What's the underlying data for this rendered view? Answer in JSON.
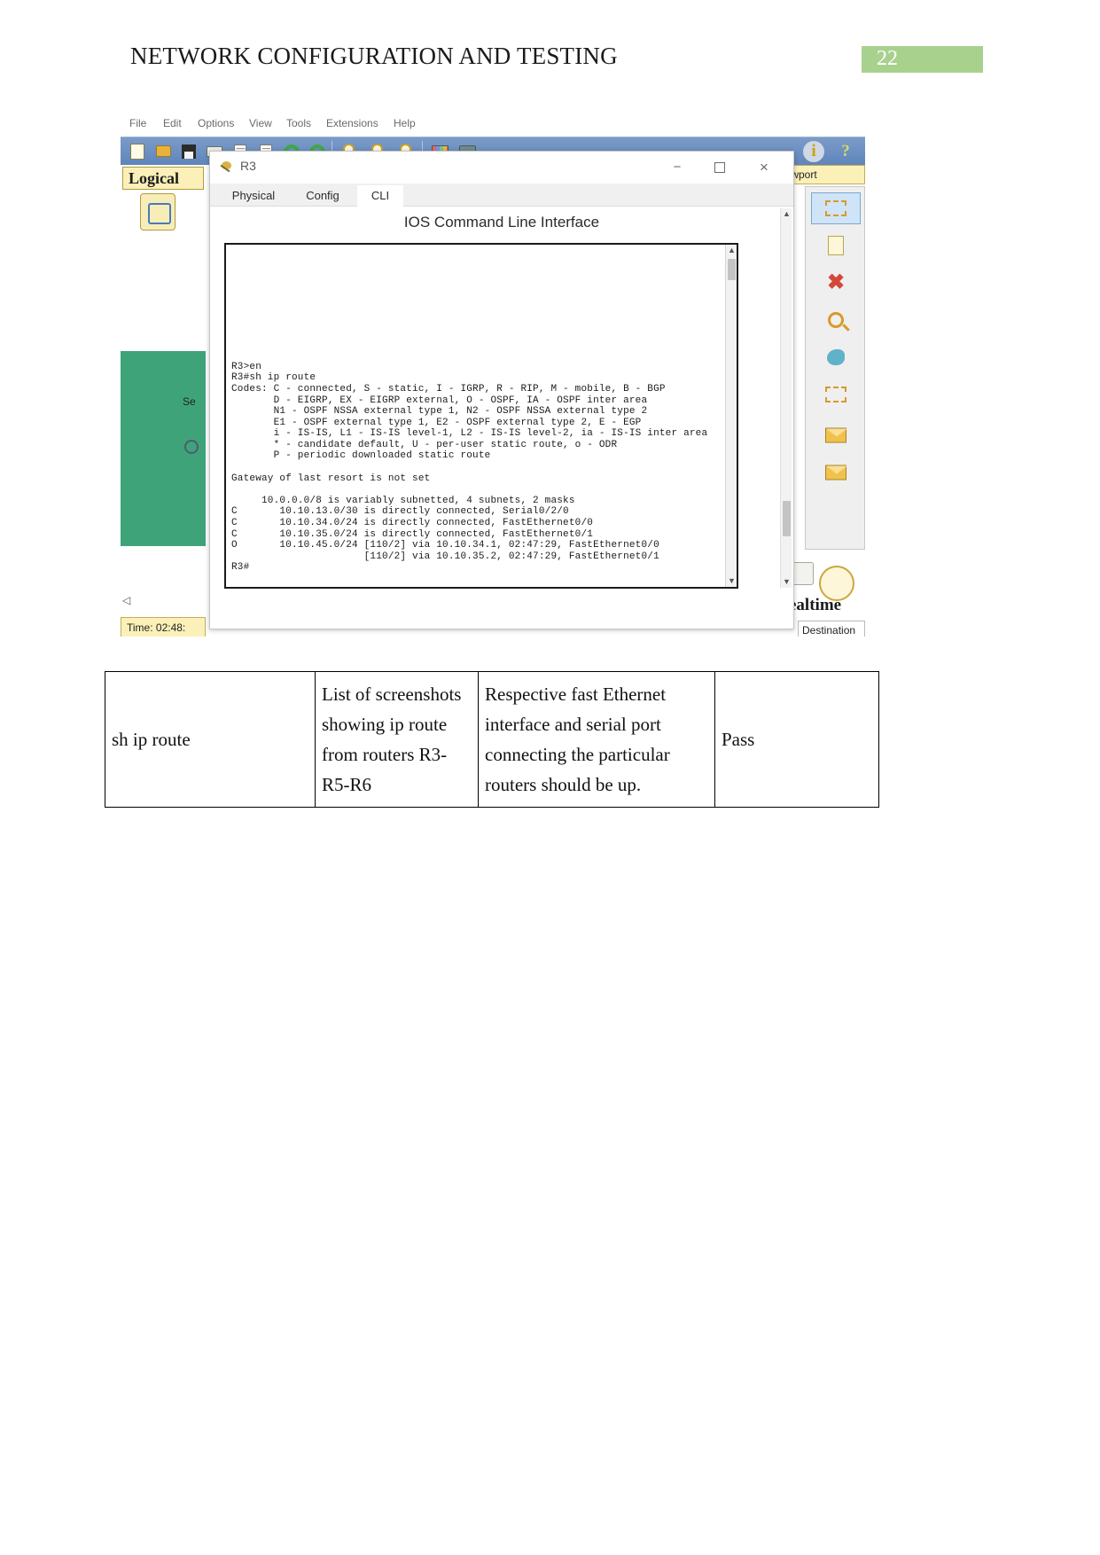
{
  "document": {
    "title": "NETWORK CONFIGURATION AND TESTING",
    "page_number": "22"
  },
  "packet_tracer": {
    "menu": [
      "File",
      "Edit",
      "Options",
      "View",
      "Tools",
      "Extensions",
      "Help"
    ],
    "toolbar_icons": [
      "new-file-icon",
      "open-folder-icon",
      "save-icon",
      "print-icon",
      "copy-icon",
      "paste-icon",
      "undo-icon",
      "redo-icon",
      "zoom-in-icon",
      "zoom-fit-icon",
      "zoom-out-icon",
      "palette-icon",
      "custom-device-icon"
    ],
    "info_icon": "i",
    "help_icon": "?",
    "logical_tab": "Logical",
    "viewport_tab": "iewport",
    "time_label": "Time: 02:48:",
    "realtime_label": "ealtime",
    "destination_label": "Destination",
    "scenario_label": "Se"
  },
  "r3_dialog": {
    "title": "R3",
    "window_buttons": {
      "minimize": "−",
      "maximize": "",
      "close": "×"
    },
    "tabs": [
      {
        "label": "Physical",
        "active": false
      },
      {
        "label": "Config",
        "active": false
      },
      {
        "label": "CLI",
        "active": true
      }
    ],
    "heading": "IOS Command Line Interface",
    "terminal_text": "R3>en\nR3#sh ip route\nCodes: C - connected, S - static, I - IGRP, R - RIP, M - mobile, B - BGP\n       D - EIGRP, EX - EIGRP external, O - OSPF, IA - OSPF inter area\n       N1 - OSPF NSSA external type 1, N2 - OSPF NSSA external type 2\n       E1 - OSPF external type 1, E2 - OSPF external type 2, E - EGP\n       i - IS-IS, L1 - IS-IS level-1, L2 - IS-IS level-2, ia - IS-IS inter area\n       * - candidate default, U - per-user static route, o - ODR\n       P - periodic downloaded static route\n\nGateway of last resort is not set\n\n     10.0.0.0/8 is variably subnetted, 4 subnets, 2 masks\nC       10.10.13.0/30 is directly connected, Serial0/2/0\nC       10.10.34.0/24 is directly connected, FastEthernet0/0\nC       10.10.35.0/24 is directly connected, FastEthernet0/1\nO       10.10.45.0/24 [110/2] via 10.10.34.1, 02:47:29, FastEthernet0/0\n                      [110/2] via 10.10.35.2, 02:47:29, FastEthernet0/1\nR3#",
    "scroll_up": "▲",
    "scroll_down": "▼"
  },
  "results_table": {
    "rows": [
      {
        "command": "sh ip route",
        "expected_evidence": "List of screenshots showing ip route from routers R3-R5-R6",
        "expected_result": "Respective fast Ethernet interface and serial port connecting the particular routers should be up.",
        "status": "Pass"
      }
    ]
  }
}
